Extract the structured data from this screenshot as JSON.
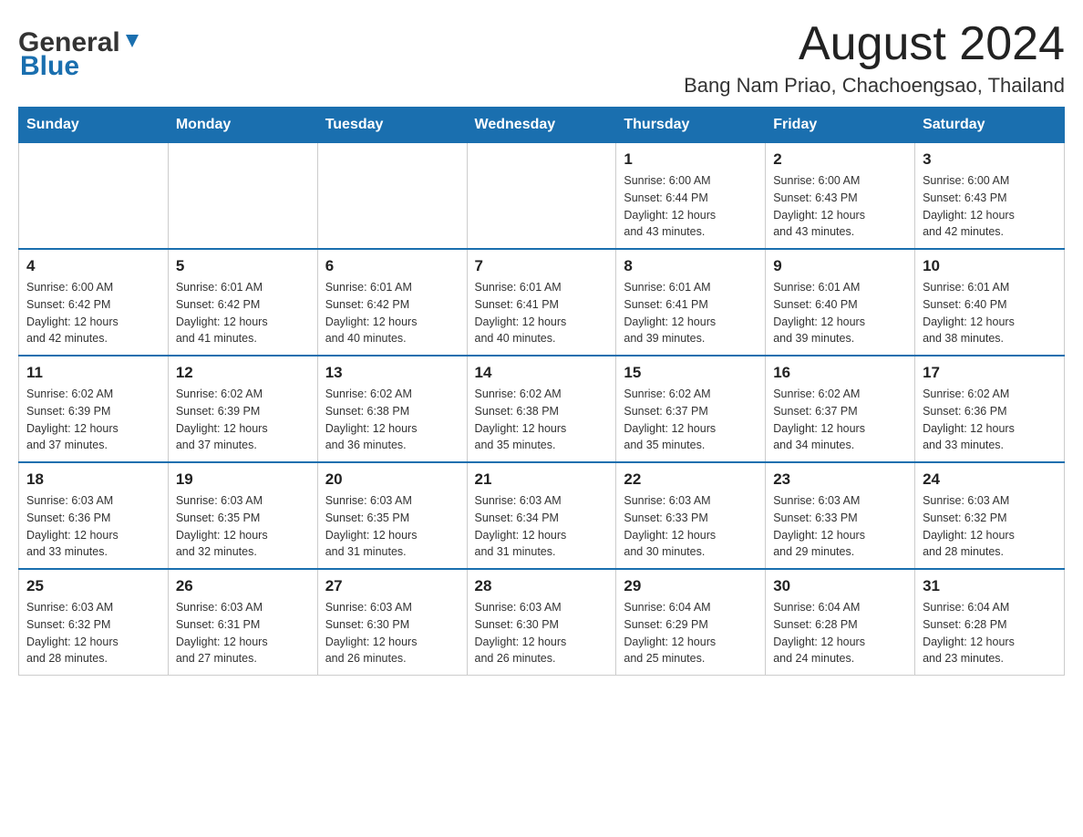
{
  "header": {
    "logo_general": "General",
    "logo_blue": "Blue",
    "month_title": "August 2024",
    "location": "Bang Nam Priao, Chachoengsao, Thailand"
  },
  "days_of_week": [
    "Sunday",
    "Monday",
    "Tuesday",
    "Wednesday",
    "Thursday",
    "Friday",
    "Saturday"
  ],
  "weeks": [
    {
      "days": [
        {
          "number": "",
          "info": ""
        },
        {
          "number": "",
          "info": ""
        },
        {
          "number": "",
          "info": ""
        },
        {
          "number": "",
          "info": ""
        },
        {
          "number": "1",
          "sunrise": "6:00 AM",
          "sunset": "6:44 PM",
          "daylight": "12 hours and 43 minutes."
        },
        {
          "number": "2",
          "sunrise": "6:00 AM",
          "sunset": "6:43 PM",
          "daylight": "12 hours and 43 minutes."
        },
        {
          "number": "3",
          "sunrise": "6:00 AM",
          "sunset": "6:43 PM",
          "daylight": "12 hours and 42 minutes."
        }
      ]
    },
    {
      "days": [
        {
          "number": "4",
          "sunrise": "6:00 AM",
          "sunset": "6:42 PM",
          "daylight": "12 hours and 42 minutes."
        },
        {
          "number": "5",
          "sunrise": "6:01 AM",
          "sunset": "6:42 PM",
          "daylight": "12 hours and 41 minutes."
        },
        {
          "number": "6",
          "sunrise": "6:01 AM",
          "sunset": "6:42 PM",
          "daylight": "12 hours and 40 minutes."
        },
        {
          "number": "7",
          "sunrise": "6:01 AM",
          "sunset": "6:41 PM",
          "daylight": "12 hours and 40 minutes."
        },
        {
          "number": "8",
          "sunrise": "6:01 AM",
          "sunset": "6:41 PM",
          "daylight": "12 hours and 39 minutes."
        },
        {
          "number": "9",
          "sunrise": "6:01 AM",
          "sunset": "6:40 PM",
          "daylight": "12 hours and 39 minutes."
        },
        {
          "number": "10",
          "sunrise": "6:01 AM",
          "sunset": "6:40 PM",
          "daylight": "12 hours and 38 minutes."
        }
      ]
    },
    {
      "days": [
        {
          "number": "11",
          "sunrise": "6:02 AM",
          "sunset": "6:39 PM",
          "daylight": "12 hours and 37 minutes."
        },
        {
          "number": "12",
          "sunrise": "6:02 AM",
          "sunset": "6:39 PM",
          "daylight": "12 hours and 37 minutes."
        },
        {
          "number": "13",
          "sunrise": "6:02 AM",
          "sunset": "6:38 PM",
          "daylight": "12 hours and 36 minutes."
        },
        {
          "number": "14",
          "sunrise": "6:02 AM",
          "sunset": "6:38 PM",
          "daylight": "12 hours and 35 minutes."
        },
        {
          "number": "15",
          "sunrise": "6:02 AM",
          "sunset": "6:37 PM",
          "daylight": "12 hours and 35 minutes."
        },
        {
          "number": "16",
          "sunrise": "6:02 AM",
          "sunset": "6:37 PM",
          "daylight": "12 hours and 34 minutes."
        },
        {
          "number": "17",
          "sunrise": "6:02 AM",
          "sunset": "6:36 PM",
          "daylight": "12 hours and 33 minutes."
        }
      ]
    },
    {
      "days": [
        {
          "number": "18",
          "sunrise": "6:03 AM",
          "sunset": "6:36 PM",
          "daylight": "12 hours and 33 minutes."
        },
        {
          "number": "19",
          "sunrise": "6:03 AM",
          "sunset": "6:35 PM",
          "daylight": "12 hours and 32 minutes."
        },
        {
          "number": "20",
          "sunrise": "6:03 AM",
          "sunset": "6:35 PM",
          "daylight": "12 hours and 31 minutes."
        },
        {
          "number": "21",
          "sunrise": "6:03 AM",
          "sunset": "6:34 PM",
          "daylight": "12 hours and 31 minutes."
        },
        {
          "number": "22",
          "sunrise": "6:03 AM",
          "sunset": "6:33 PM",
          "daylight": "12 hours and 30 minutes."
        },
        {
          "number": "23",
          "sunrise": "6:03 AM",
          "sunset": "6:33 PM",
          "daylight": "12 hours and 29 minutes."
        },
        {
          "number": "24",
          "sunrise": "6:03 AM",
          "sunset": "6:32 PM",
          "daylight": "12 hours and 28 minutes."
        }
      ]
    },
    {
      "days": [
        {
          "number": "25",
          "sunrise": "6:03 AM",
          "sunset": "6:32 PM",
          "daylight": "12 hours and 28 minutes."
        },
        {
          "number": "26",
          "sunrise": "6:03 AM",
          "sunset": "6:31 PM",
          "daylight": "12 hours and 27 minutes."
        },
        {
          "number": "27",
          "sunrise": "6:03 AM",
          "sunset": "6:30 PM",
          "daylight": "12 hours and 26 minutes."
        },
        {
          "number": "28",
          "sunrise": "6:03 AM",
          "sunset": "6:30 PM",
          "daylight": "12 hours and 26 minutes."
        },
        {
          "number": "29",
          "sunrise": "6:04 AM",
          "sunset": "6:29 PM",
          "daylight": "12 hours and 25 minutes."
        },
        {
          "number": "30",
          "sunrise": "6:04 AM",
          "sunset": "6:28 PM",
          "daylight": "12 hours and 24 minutes."
        },
        {
          "number": "31",
          "sunrise": "6:04 AM",
          "sunset": "6:28 PM",
          "daylight": "12 hours and 23 minutes."
        }
      ]
    }
  ],
  "labels": {
    "sunrise_prefix": "Sunrise: ",
    "sunset_prefix": "Sunset: ",
    "daylight_prefix": "Daylight: "
  }
}
